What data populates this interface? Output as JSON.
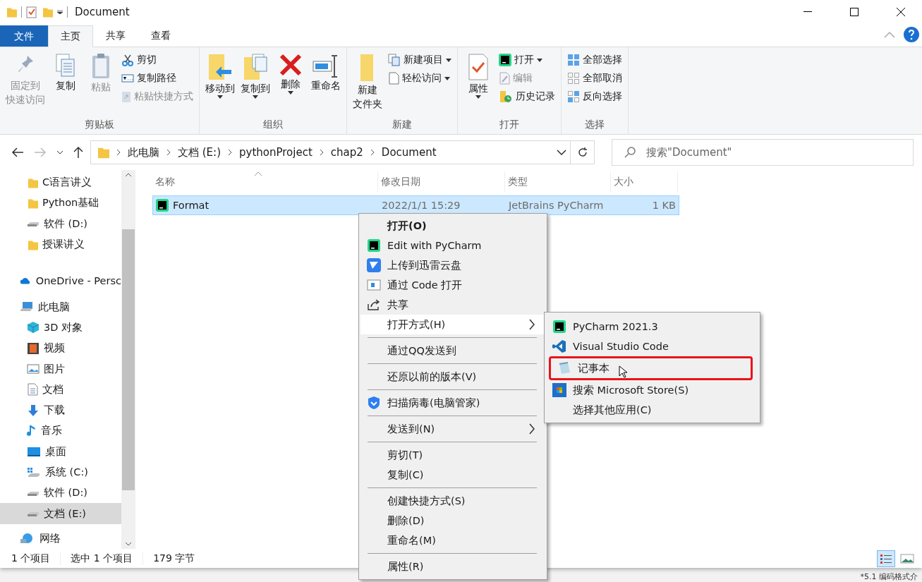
{
  "window": {
    "title": "Document"
  },
  "ribbon": {
    "tabs": [
      {
        "label": "文件",
        "kind": "file",
        "selected": false
      },
      {
        "label": "主页",
        "kind": "tab",
        "selected": true
      },
      {
        "label": "共享",
        "kind": "tab",
        "selected": false
      },
      {
        "label": "查看",
        "kind": "tab",
        "selected": false
      }
    ],
    "groups": [
      {
        "label": "剪贴板",
        "buttons": [
          {
            "label": [
              "固定到",
              "快速访问"
            ],
            "kind": "large",
            "disabled": true,
            "dropdown": false
          },
          {
            "label": "复制",
            "kind": "large",
            "disabled": false,
            "dropdown": false
          },
          {
            "label": "粘贴",
            "kind": "large",
            "disabled": true,
            "dropdown": false
          },
          {
            "label": "剪切",
            "kind": "small",
            "disabled": false,
            "dropdown": false
          },
          {
            "label": "复制路径",
            "kind": "small",
            "disabled": false,
            "dropdown": false
          },
          {
            "label": "粘贴快捷方式",
            "kind": "small",
            "disabled": true,
            "dropdown": false
          }
        ]
      },
      {
        "label": "组织",
        "buttons": [
          {
            "label": "移动到",
            "kind": "large",
            "disabled": false,
            "dropdown": true
          },
          {
            "label": "复制到",
            "kind": "large",
            "disabled": false,
            "dropdown": true
          },
          {
            "label": "删除",
            "kind": "large",
            "disabled": false,
            "dropdown": true
          },
          {
            "label": "重命名",
            "kind": "large",
            "disabled": false,
            "dropdown": false
          }
        ]
      },
      {
        "label": "新建",
        "buttons": [
          {
            "label": [
              "新建",
              "文件夹"
            ],
            "kind": "large",
            "disabled": false,
            "dropdown": false
          },
          {
            "label": "新建项目",
            "kind": "small",
            "disabled": false,
            "dropdown": true
          },
          {
            "label": "轻松访问",
            "kind": "small",
            "disabled": false,
            "dropdown": true
          }
        ]
      },
      {
        "label": "打开",
        "buttons": [
          {
            "label": "属性",
            "kind": "large",
            "disabled": false,
            "dropdown": true
          },
          {
            "label": "打开",
            "kind": "small",
            "disabled": false,
            "dropdown": true
          },
          {
            "label": "编辑",
            "kind": "small",
            "disabled": true,
            "dropdown": false
          },
          {
            "label": "历史记录",
            "kind": "small",
            "disabled": false,
            "dropdown": false
          }
        ]
      },
      {
        "label": "选择",
        "buttons": [
          {
            "label": "全部选择",
            "kind": "small",
            "disabled": false,
            "dropdown": false
          },
          {
            "label": "全部取消",
            "kind": "small",
            "disabled": false,
            "dropdown": false
          },
          {
            "label": "反向选择",
            "kind": "small",
            "disabled": false,
            "dropdown": false
          }
        ]
      }
    ]
  },
  "address_bar": {
    "path": [
      "此电脑",
      "文档 (E:)",
      "pythonProject",
      "chap2",
      "Document"
    ],
    "search": {
      "placeholder": "搜索\"Document\""
    }
  },
  "navigation": [
    {
      "label": "C语言讲义",
      "selected": false
    },
    {
      "label": "Python基础",
      "selected": false
    },
    {
      "label": "软件 (D:)",
      "selected": false
    },
    {
      "label": "授课讲义",
      "selected": false
    },
    {
      "label": "OneDrive - Persc",
      "selected": false
    },
    {
      "label": "此电脑",
      "selected": false,
      "children": [
        {
          "label": "3D 对象",
          "selected": false
        },
        {
          "label": "视频",
          "selected": false
        },
        {
          "label": "图片",
          "selected": false
        },
        {
          "label": "文档",
          "selected": false
        },
        {
          "label": "下载",
          "selected": false
        },
        {
          "label": "音乐",
          "selected": false
        },
        {
          "label": "桌面",
          "selected": false
        },
        {
          "label": "系统 (C:)",
          "selected": false
        },
        {
          "label": "软件 (D:)",
          "selected": false
        },
        {
          "label": "文档 (E:)",
          "selected": true
        }
      ]
    },
    {
      "label": "网络",
      "selected": false
    }
  ],
  "file_list": {
    "columns": [
      {
        "label": "名称",
        "sorted": true
      },
      {
        "label": "修改日期",
        "sorted": false
      },
      {
        "label": "类型",
        "sorted": false
      },
      {
        "label": "大小",
        "sorted": false
      }
    ],
    "rows": [
      {
        "name": "Format",
        "date": "2022/1/1 15:29",
        "type": "JetBrains PyCharm",
        "size": "1 KB",
        "selected": true
      }
    ]
  },
  "context_menu": {
    "items": [
      {
        "kind": "item",
        "label": "打开(O)",
        "default": true,
        "highlighted": false,
        "submenu": false
      },
      {
        "kind": "item",
        "label": "Edit with PyCharm",
        "default": false,
        "highlighted": false,
        "submenu": false
      },
      {
        "kind": "item",
        "label": "上传到迅雷云盘",
        "default": false,
        "highlighted": false,
        "submenu": false
      },
      {
        "kind": "item",
        "label": "通过 Code 打开",
        "default": false,
        "highlighted": false,
        "submenu": false
      },
      {
        "kind": "item",
        "label": "共享",
        "default": false,
        "highlighted": false,
        "submenu": false
      },
      {
        "kind": "item",
        "label": "打开方式(H)",
        "default": false,
        "highlighted": true,
        "submenu": true
      },
      {
        "kind": "separator"
      },
      {
        "kind": "item",
        "label": "通过QQ发送到",
        "default": false,
        "highlighted": false,
        "submenu": false
      },
      {
        "kind": "separator"
      },
      {
        "kind": "item",
        "label": "还原以前的版本(V)",
        "default": false,
        "highlighted": false,
        "submenu": false
      },
      {
        "kind": "separator"
      },
      {
        "kind": "item",
        "label": "扫描病毒(电脑管家)",
        "default": false,
        "highlighted": false,
        "submenu": false
      },
      {
        "kind": "separator"
      },
      {
        "kind": "item",
        "label": "发送到(N)",
        "default": false,
        "highlighted": false,
        "submenu": true
      },
      {
        "kind": "separator"
      },
      {
        "kind": "item",
        "label": "剪切(T)",
        "default": false,
        "highlighted": false,
        "submenu": false
      },
      {
        "kind": "item",
        "label": "复制(C)",
        "default": false,
        "highlighted": false,
        "submenu": false
      },
      {
        "kind": "separator"
      },
      {
        "kind": "item",
        "label": "创建快捷方式(S)",
        "default": false,
        "highlighted": false,
        "submenu": false
      },
      {
        "kind": "item",
        "label": "删除(D)",
        "default": false,
        "highlighted": false,
        "submenu": false
      },
      {
        "kind": "item",
        "label": "重命名(M)",
        "default": false,
        "highlighted": false,
        "submenu": false
      },
      {
        "kind": "separator"
      },
      {
        "kind": "item",
        "label": "属性(R)",
        "default": false,
        "highlighted": false,
        "submenu": false
      }
    ],
    "submenu": [
      {
        "label": "PyCharm 2021.3",
        "annotated": false
      },
      {
        "label": "Visual Studio Code",
        "annotated": false
      },
      {
        "label": "记事本",
        "annotated": true
      },
      {
        "label": "搜索 Microsoft Store(S)",
        "annotated": false
      },
      {
        "label": "选择其他应用(C)",
        "annotated": false
      }
    ]
  },
  "status_bar": {
    "items": [
      "1 个项目",
      "选中 1 个项目",
      "179 字节"
    ],
    "views": [
      {
        "kind": "details",
        "selected": true
      },
      {
        "kind": "large_icons",
        "selected": false
      }
    ]
  },
  "background_text": "*5.1 编码格式介"
}
